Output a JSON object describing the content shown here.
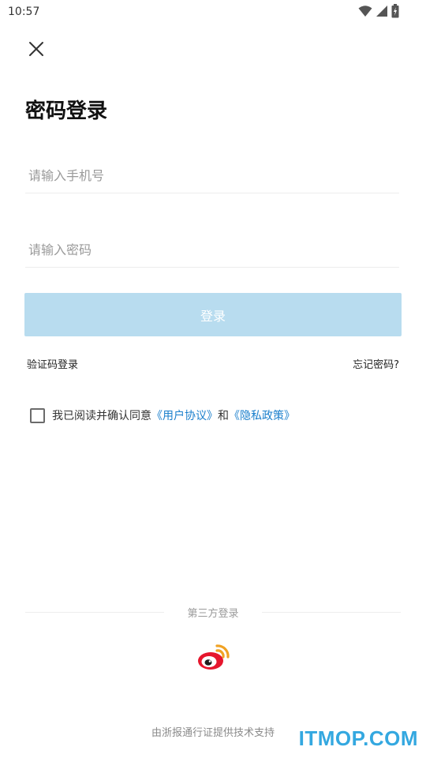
{
  "status_bar": {
    "time": "10:57",
    "icons": [
      "wifi-icon",
      "cell-signal-icon",
      "battery-icon"
    ]
  },
  "header": {
    "close_icon": "close-icon",
    "title": "密码登录"
  },
  "form": {
    "phone_placeholder": "请输入手机号",
    "phone_value": "",
    "password_placeholder": "请输入密码",
    "password_value": "",
    "login_label": "登录",
    "sms_login_label": "验证码登录",
    "forgot_label": "忘记密码?"
  },
  "agreement": {
    "checked": false,
    "prefix": "我已阅读并确认同意",
    "user_agreement": "《用户协议》",
    "conjunction": "和",
    "privacy_policy": "《隐私政策》"
  },
  "third_party": {
    "label": "第三方登录",
    "providers": [
      "weibo-icon"
    ]
  },
  "footer": {
    "text": "由浙报通行证提供技术支持"
  },
  "watermark": {
    "text": "ITMOP.COM"
  },
  "colors": {
    "login_button_bg": "#b8dcef",
    "link_blue": "#1a7fcc",
    "watermark_blue": "#34a8e0",
    "weibo_red": "#e6162d",
    "weibo_orange": "#f0a224"
  }
}
